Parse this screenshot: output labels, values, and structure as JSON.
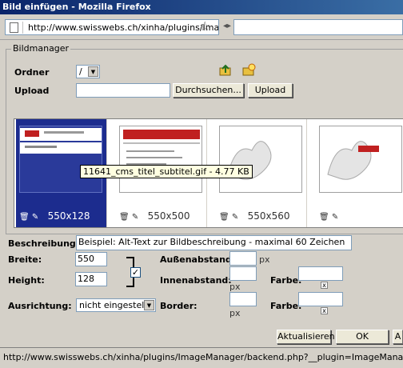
{
  "window": {
    "title": "Bild einfügen - Mozilla Firefox"
  },
  "browser": {
    "url": "http://www.swisswebs.ch/xinha/plugins/Ima",
    "status_url": "http://www.swisswebs.ch/xinha/plugins/ImageManager/backend.php?__plugin=ImageManager&__func"
  },
  "manager": {
    "legend": "Bildmanager",
    "folder_label": "Ordner",
    "folder_value": "/",
    "upload_label": "Upload",
    "browse_button": "Durchsuchen...",
    "upload_button": "Upload"
  },
  "thumbnails": [
    {
      "dims": "550x128",
      "selected": true
    },
    {
      "dims": "550x500",
      "selected": false
    },
    {
      "dims": "550x560",
      "selected": false
    },
    {
      "dims": "",
      "selected": false
    }
  ],
  "tooltip": "11641_cms_titel_subtitel.gif - 4.77 KB",
  "form": {
    "description_label": "Beschreibung:",
    "description_value": "Beispiel: Alt-Text zur Bildbeschreibung - maximal 60 Zeichen",
    "width_label": "Breite:",
    "width_value": "550",
    "height_label": "Height:",
    "height_value": "128",
    "margin_label": "Außenabstand:",
    "padding_label": "Innenabstand:",
    "align_label": "Ausrichtung:",
    "align_value": "nicht eingestellt",
    "border_label": "Border:",
    "color_label": "Farbe:",
    "unit_px": "px",
    "clear_x": "x"
  },
  "buttons": {
    "refresh": "Aktualisieren",
    "ok": "OK",
    "cancel": "A"
  }
}
